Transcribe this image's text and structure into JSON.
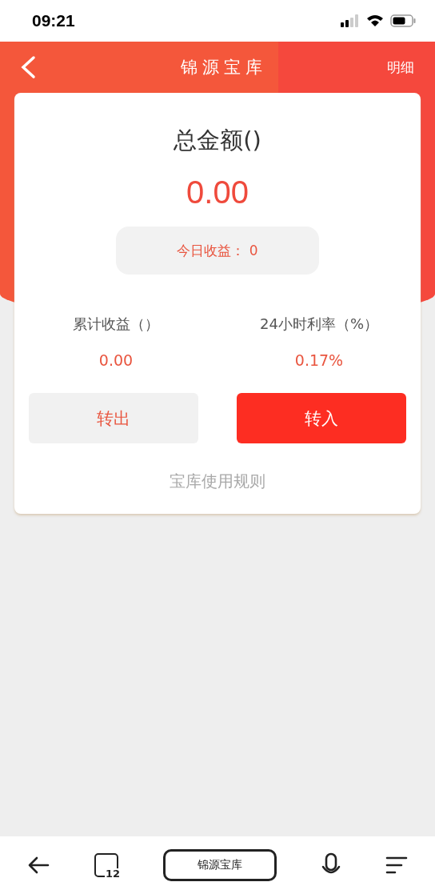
{
  "status_bar": {
    "time": "09:21"
  },
  "header": {
    "title": "锦源宝库",
    "action": "明细"
  },
  "summary": {
    "title": "总金额()",
    "amount": "0.00",
    "today": "今日收益： 0"
  },
  "stats": [
    {
      "label": "累计收益（）",
      "value": "0.00"
    },
    {
      "label": "24小时利率（%）",
      "value": "0.17%"
    }
  ],
  "buttons": [
    {
      "label": "转出",
      "kind": "secondary"
    },
    {
      "label": "转入",
      "kind": "primary"
    }
  ],
  "rules_link": "宝库使用规则",
  "browser_bar": {
    "tab_count": "12",
    "address": "锦源宝库"
  }
}
